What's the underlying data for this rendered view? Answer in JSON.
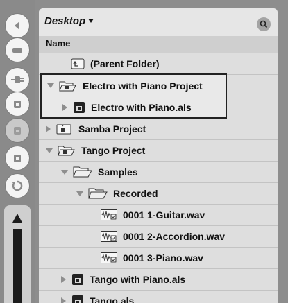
{
  "sidebar": {
    "buttons": [
      {
        "name": "back-arrow-icon",
        "state": "active"
      },
      {
        "name": "minimize-icon",
        "state": "active"
      },
      {
        "name": "plugin-icon",
        "state": "active"
      },
      {
        "name": "place-1-icon",
        "state": "active"
      },
      {
        "name": "place-2-icon",
        "state": "dim"
      },
      {
        "name": "place-3-icon",
        "state": "active"
      },
      {
        "name": "refresh-icon",
        "state": "active"
      }
    ]
  },
  "browser": {
    "location": "Desktop",
    "column_header": "Name",
    "items": [
      {
        "label": "(Parent Folder)",
        "type": "parent-folder",
        "expand": "none",
        "indent": 1
      },
      {
        "label": "Electro with Piano Project",
        "type": "project-folder",
        "expand": "open",
        "indent": 0
      },
      {
        "label": "Electro with Piano.als",
        "type": "live-set",
        "expand": "closed",
        "indent": 1
      },
      {
        "label": "Samba Project",
        "type": "project-folder",
        "expand": "closed",
        "indent": 0
      },
      {
        "label": "Tango Project",
        "type": "project-folder",
        "expand": "open",
        "indent": 0
      },
      {
        "label": "Samples",
        "type": "folder",
        "expand": "open",
        "indent": 1
      },
      {
        "label": "Recorded",
        "type": "folder",
        "expand": "open",
        "indent": 2
      },
      {
        "label": "0001 1-Guitar.wav",
        "type": "audio-file",
        "expand": "none",
        "indent": 3
      },
      {
        "label": "0001 2-Accordion.wav",
        "type": "audio-file",
        "expand": "none",
        "indent": 3
      },
      {
        "label": "0001 3-Piano.wav",
        "type": "audio-file",
        "expand": "none",
        "indent": 3
      },
      {
        "label": "Tango with Piano.als",
        "type": "live-set",
        "expand": "closed",
        "indent": 1
      },
      {
        "label": "Tango.als",
        "type": "live-set",
        "expand": "closed",
        "indent": 1
      }
    ]
  },
  "colors": {
    "background": "#8d8d8d",
    "panel": "#dedede",
    "highlight_border": "#222222"
  }
}
